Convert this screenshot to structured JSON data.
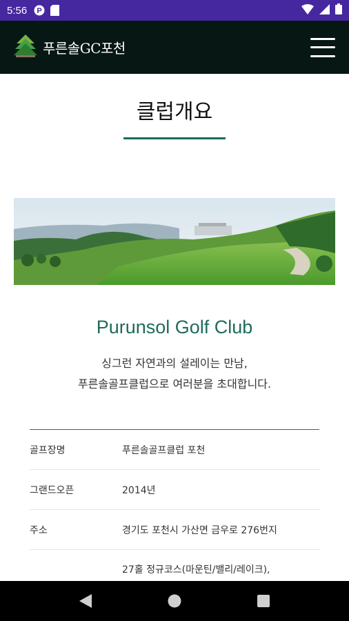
{
  "status_bar": {
    "time": "5:56",
    "icons": [
      "notification-p-icon",
      "sd-card-icon",
      "wifi-icon",
      "signal-icon",
      "battery-icon"
    ]
  },
  "header": {
    "logo_text": "푸른솔GC포천",
    "logo_icon": "pine-tree-logo-icon",
    "menu_icon": "hamburger-menu-icon"
  },
  "page": {
    "title": "클럽개요",
    "club_name": "Purunsol Golf Club",
    "description_line1": "싱그런 자연과의 설레이는 만남,",
    "description_line2": "푸른솔골프클럽으로 여러분을 초대합니다."
  },
  "info": {
    "rows": [
      {
        "label": "골프장명",
        "value": "푸른솔골프클럽 포천"
      },
      {
        "label": "그랜드오픈",
        "value": "2014년"
      },
      {
        "label": "주소",
        "value": "경기도 포천시 가산면 금우로 276번지"
      },
      {
        "label": "",
        "value": "27홀 정규코스(마운틴/밸리/레이크),"
      }
    ]
  },
  "colors": {
    "status_bar": "#4527a0",
    "header_bg": "#071713",
    "accent": "#1f6b5c"
  },
  "nav": {
    "icons": [
      "back-triangle-icon",
      "home-circle-icon",
      "recents-square-icon"
    ]
  }
}
